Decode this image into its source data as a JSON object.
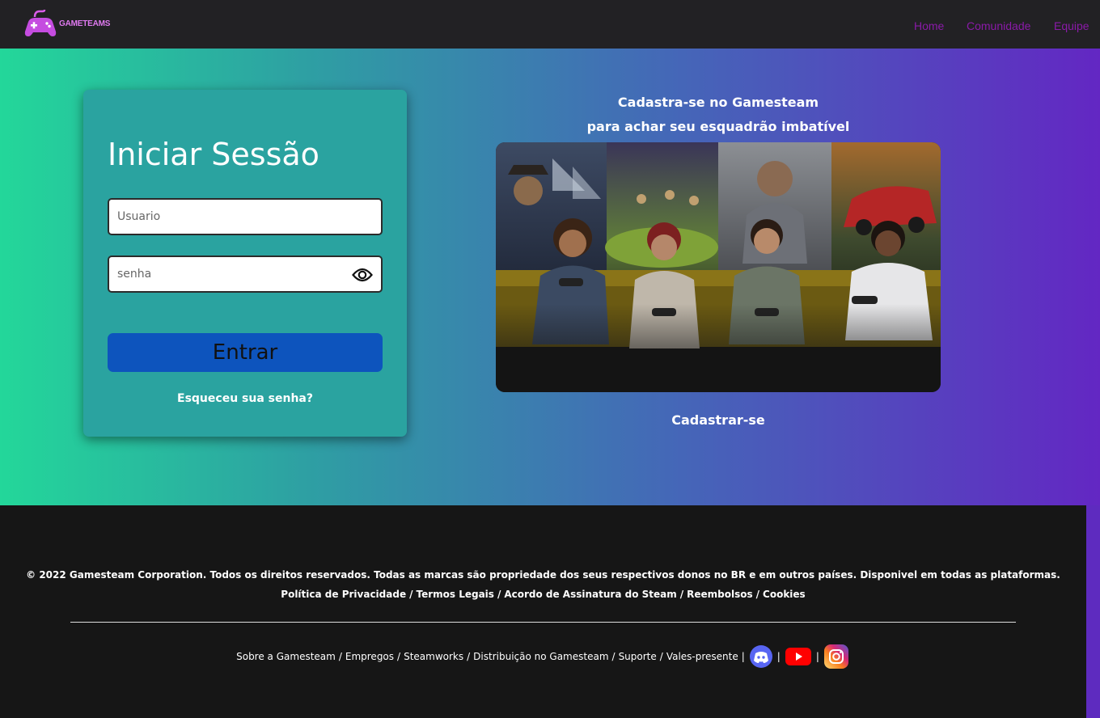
{
  "nav": {
    "brand": "GAMETEAMS",
    "links": [
      "Home",
      "Comunidade",
      "Equipe"
    ]
  },
  "login": {
    "title": "Iniciar Sessão",
    "username_placeholder": "Usuario",
    "password_placeholder": "senha",
    "submit_label": "Entrar",
    "forgot_label": "Esqueceu sua senha?"
  },
  "promo": {
    "line1": "Cadastra-se no Gamesteam",
    "line2": "para achar seu esquadrão imbatível",
    "signup_label": "Cadastrar-se"
  },
  "footer": {
    "copyright": "© 2022 Gamesteam Corporation. Todos os direitos reservados. Todas as marcas são propriedade dos seus respectivos donos no BR e em outros países. Disponivel em todas as plataformas.",
    "legal_links": [
      "Política de Privacidade",
      "Termos Legais",
      "Acordo de Assinatura do Steam",
      "Reembolsos",
      "Cookies"
    ],
    "bottom_links": [
      "Sobre a Gamesteam",
      "Empregos",
      "Steamworks",
      "Distribuição no Gamesteam",
      "Suporte",
      "Vales-presente"
    ],
    "social_icons": [
      "discord-icon",
      "youtube-icon",
      "instagram-icon"
    ]
  },
  "colors": {
    "nav_bg": "#222124",
    "nav_link": "#8a1aa8",
    "hero_gradient_start": "#23d79a",
    "hero_gradient_end": "#6327c3",
    "card_bg": "#2aa3a0",
    "button_bg": "#0d54bd",
    "footer_bg": "#161616"
  }
}
